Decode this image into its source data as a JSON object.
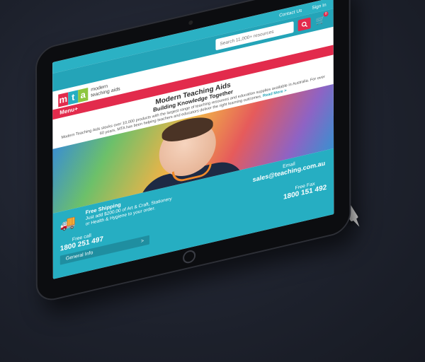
{
  "header": {
    "contact_link": "Contact Us",
    "signin_link": "Sign In",
    "search_placeholder": "Search 11,000+ resources",
    "cart_count": "0"
  },
  "logo": {
    "letters": [
      "m",
      "t",
      "a"
    ],
    "line1": "modern",
    "line2": "teaching aids"
  },
  "menu": {
    "label": "Menu+"
  },
  "intro": {
    "title": "Modern Teaching Aids",
    "subtitle": "Building Knowledge Together",
    "body": "Modern Teaching Aids stocks over 10,000 products with the largest range of teaching resources and education supplies available in Australia. For over 60 years, MTA has been helping teachers and educators deliver the right learning outcomes.",
    "read_more": "Read More >"
  },
  "info": {
    "shipping_title": "Free Shipping",
    "shipping_line1": "Just add $200.00 of Art & Craft, Stationery",
    "shipping_line2": "or Health & Hygiene to your order.",
    "email_label": "Email",
    "email_value": "sales@teaching.com.au",
    "call_label": "Free call",
    "call_value": "1800 251 497",
    "fax_label": "Free Fax",
    "fax_value": "1800 151 492",
    "general_label": "General Info",
    "general_arrow": ">"
  },
  "colors": {
    "teal": "#26aec2",
    "red": "#e22b4c",
    "logo_m": "#e22b4c",
    "logo_t": "#26aec2",
    "logo_a": "#8dc63f"
  }
}
